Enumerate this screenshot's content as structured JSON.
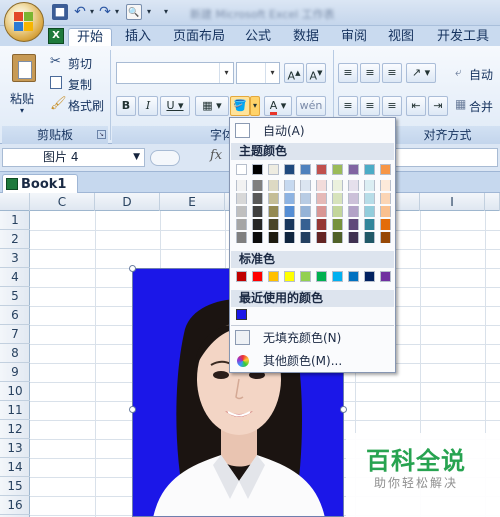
{
  "tabs": [
    {
      "label": "开始",
      "active": true
    },
    {
      "label": "插入"
    },
    {
      "label": "页面布局"
    },
    {
      "label": "公式"
    },
    {
      "label": "数据"
    },
    {
      "label": "审阅"
    },
    {
      "label": "视图"
    },
    {
      "label": "开发工具"
    }
  ],
  "title_blurred": "新建 Microsoft Excel 工作表",
  "clipboard": {
    "paste": "粘贴",
    "cut": "剪切",
    "copy": "复制",
    "format_painter": "格式刷",
    "group_label": "剪贴板"
  },
  "font_group": {
    "label": "字体",
    "font_name": "",
    "font_size": ""
  },
  "align_group": {
    "label": "对齐方式",
    "auto_wrap": "自动",
    "merge": "合并"
  },
  "name_box": {
    "value": "图片 4"
  },
  "formula": {
    "fx": "fx",
    "value": ""
  },
  "workbook": {
    "name": "Book1 *"
  },
  "columns": [
    "C",
    "D",
    "E",
    "",
    "",
    "I",
    ""
  ],
  "rows": [
    "1",
    "2",
    "3",
    "4",
    "5",
    "6",
    "7",
    "8",
    "9",
    "10",
    "11",
    "12",
    "13",
    "14",
    "15",
    "16"
  ],
  "color_menu": {
    "auto": "自动(A)",
    "theme_header": "主题颜色",
    "standard_header": "标准色",
    "recent_header": "最近使用的颜色",
    "no_fill": "无填充颜色(N)",
    "more": "其他颜色(M)...",
    "theme_top": [
      "#ffffff",
      "#000000",
      "#eeece1",
      "#1f497d",
      "#4f81bd",
      "#c0504d",
      "#9bbb59",
      "#8064a2",
      "#4bacc6",
      "#f79646"
    ],
    "theme_cols": [
      [
        "#f2f2f2",
        "#d8d8d8",
        "#bfbfbf",
        "#a5a5a5",
        "#7f7f7f"
      ],
      [
        "#7f7f7f",
        "#595959",
        "#3f3f3f",
        "#262626",
        "#0c0c0c"
      ],
      [
        "#ddd9c3",
        "#c4bd97",
        "#938953",
        "#494429",
        "#1d1b10"
      ],
      [
        "#c6d9f0",
        "#8db3e2",
        "#548dd4",
        "#17365d",
        "#0f243e"
      ],
      [
        "#dbe5f1",
        "#b8cce4",
        "#95b3d7",
        "#366092",
        "#244061"
      ],
      [
        "#f2dcdb",
        "#e5b9b7",
        "#d99694",
        "#953734",
        "#632423"
      ],
      [
        "#ebf1dd",
        "#d7e3bc",
        "#c3d69b",
        "#76923c",
        "#4f6128"
      ],
      [
        "#e5e0ec",
        "#ccc1d9",
        "#b2a2c7",
        "#5f497a",
        "#3f3151"
      ],
      [
        "#dbeef3",
        "#b7dde8",
        "#92cddc",
        "#31859b",
        "#205867"
      ],
      [
        "#fdeada",
        "#fbd5b5",
        "#fac08f",
        "#e36c09",
        "#974806"
      ]
    ],
    "standard": [
      "#c00000",
      "#ff0000",
      "#ffc000",
      "#ffff00",
      "#92d050",
      "#00b050",
      "#00b0f0",
      "#0070c0",
      "#002060",
      "#7030a0"
    ],
    "recent": [
      "#1b17e8"
    ]
  },
  "photo_bg": "#1b17e8",
  "watermark": {
    "title": "百科全说",
    "subtitle": "助你轻松解决"
  }
}
